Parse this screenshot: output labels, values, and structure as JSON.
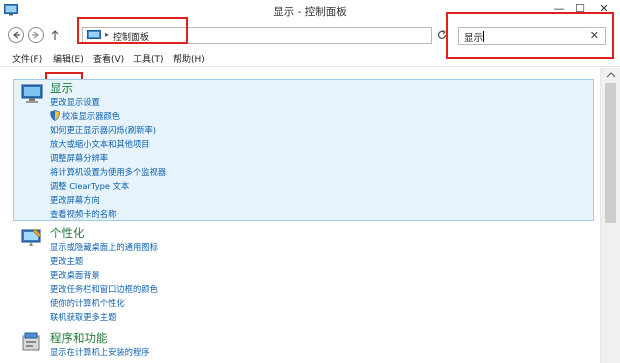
{
  "window": {
    "title": "显示 - 控制面板",
    "minimize_glyph": "—",
    "maximize_glyph": "☐",
    "close_glyph": "✕"
  },
  "nav": {
    "address_path": "控制面板",
    "address_separator": "▸",
    "search_value": "显示",
    "search_clear": "✕"
  },
  "menu": {
    "items": [
      "文件(F)",
      "编辑(E)",
      "查看(V)",
      "工具(T)",
      "帮助(H)"
    ]
  },
  "categories": [
    {
      "title": "显示",
      "links": [
        "更改显示设置",
        "校准显示器颜色",
        "如何更正显示器闪烁(刷新率)",
        "放大或缩小文本和其他项目",
        "调整屏幕分辨率",
        "将计算机设置为使用多个监视器",
        "调整 ClearType 文本",
        "更改屏幕方向",
        "查看视频卡的名称"
      ]
    },
    {
      "title": "个性化",
      "links": [
        "显示或隐藏桌面上的通用图标",
        "更改主题",
        "更改桌面背景",
        "更改任务栏和窗口边框的颜色",
        "使你的计算机个性化",
        "联机获取更多主题"
      ]
    },
    {
      "title": "程序和功能",
      "links": [
        "显示在计算机上安装的程序"
      ]
    }
  ],
  "colors": {
    "accent_red": "#e02020",
    "category_green": "#1f7a3c",
    "link_blue": "#0b5fb0",
    "selection_bg": "#e6f3fa"
  },
  "icons": [
    "control-panel-icon",
    "back-arrow-icon",
    "forward-arrow-icon",
    "up-arrow-icon",
    "refresh-icon",
    "display-icon",
    "personalization-icon",
    "programs-icon",
    "shield-icon"
  ]
}
